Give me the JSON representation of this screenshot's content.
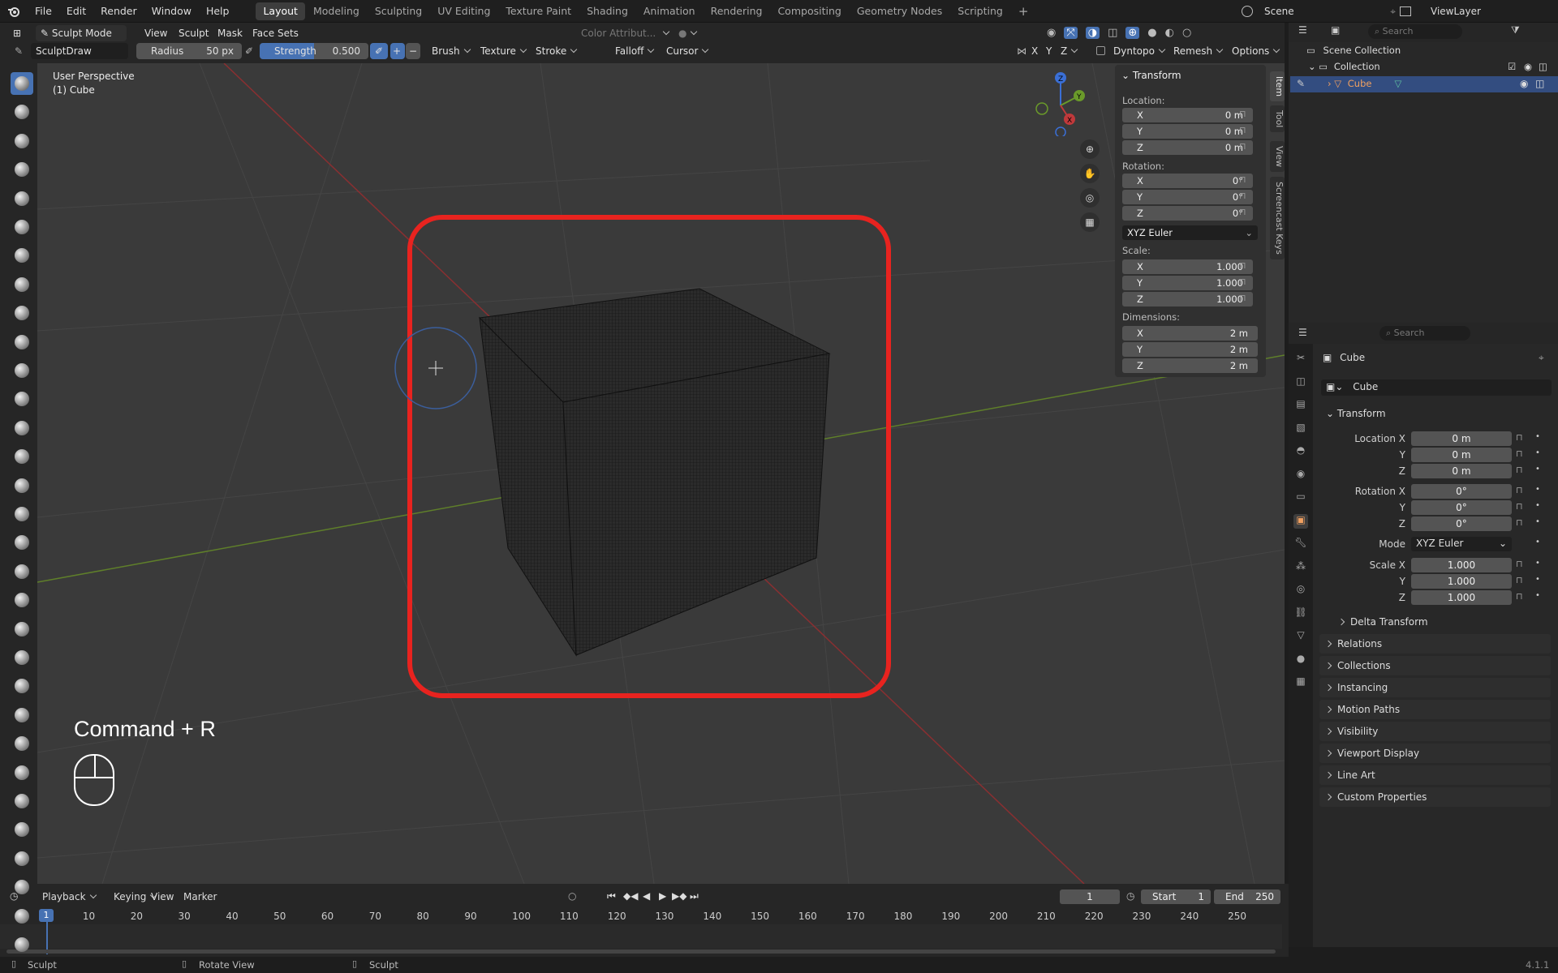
{
  "topbar": {
    "menus": [
      "File",
      "Edit",
      "Render",
      "Window",
      "Help"
    ],
    "workspaces": [
      "Layout",
      "Modeling",
      "Sculpting",
      "UV Editing",
      "Texture Paint",
      "Shading",
      "Animation",
      "Rendering",
      "Compositing",
      "Geometry Nodes",
      "Scripting"
    ],
    "active_workspace": "Layout",
    "scene": "Scene",
    "view_layer": "ViewLayer"
  },
  "header": {
    "mode": "Sculpt Mode",
    "menus": [
      "View",
      "Sculpt",
      "Mask",
      "Face Sets"
    ],
    "color_attr": "Color Attribut...",
    "brush_name": "SculptDraw",
    "radius_label": "Radius",
    "radius_value": "50 px",
    "strength_label": "Strength",
    "strength_value": "0.500",
    "dropdowns": [
      "Brush",
      "Texture",
      "Stroke",
      "Falloff",
      "Cursor"
    ],
    "axes": [
      "X",
      "Y",
      "Z"
    ],
    "dyntopo": "Dyntopo",
    "remesh": "Remesh",
    "options": "Options"
  },
  "viewport": {
    "perspective": "User Perspective",
    "object": "(1) Cube",
    "shortcut": "Command + R"
  },
  "npanel": {
    "title": "Transform",
    "location_label": "Location:",
    "location": [
      {
        "ax": "X",
        "v": "0 m"
      },
      {
        "ax": "Y",
        "v": "0 m"
      },
      {
        "ax": "Z",
        "v": "0 m"
      }
    ],
    "rotation_label": "Rotation:",
    "rotation": [
      {
        "ax": "X",
        "v": "0°"
      },
      {
        "ax": "Y",
        "v": "0°"
      },
      {
        "ax": "Z",
        "v": "0°"
      }
    ],
    "rotation_mode": "XYZ Euler",
    "scale_label": "Scale:",
    "scale": [
      {
        "ax": "X",
        "v": "1.000"
      },
      {
        "ax": "Y",
        "v": "1.000"
      },
      {
        "ax": "Z",
        "v": "1.000"
      }
    ],
    "dimensions_label": "Dimensions:",
    "dimensions": [
      {
        "ax": "X",
        "v": "2 m"
      },
      {
        "ax": "Y",
        "v": "2 m"
      },
      {
        "ax": "Z",
        "v": "2 m"
      }
    ],
    "tabs": [
      "Item",
      "Tool",
      "View",
      "Screencast Keys"
    ]
  },
  "outliner": {
    "search_placeholder": "Search",
    "scene_collection": "Scene Collection",
    "collection": "Collection",
    "object": "Cube"
  },
  "properties": {
    "search_placeholder": "Search",
    "object_name": "Cube",
    "datablock": "Cube",
    "transform": "Transform",
    "location_x_label": "Location X",
    "y_label": "Y",
    "z_label": "Z",
    "location": [
      "0 m",
      "0 m",
      "0 m"
    ],
    "rotation_x_label": "Rotation X",
    "rotation": [
      "0°",
      "0°",
      "0°"
    ],
    "mode_label": "Mode",
    "mode_value": "XYZ Euler",
    "scale_x_label": "Scale X",
    "scale": [
      "1.000",
      "1.000",
      "1.000"
    ],
    "delta": "Delta Transform",
    "sections": [
      "Relations",
      "Collections",
      "Instancing",
      "Motion Paths",
      "Visibility",
      "Viewport Display",
      "Line Art",
      "Custom Properties"
    ]
  },
  "timeline": {
    "menus": [
      "Playback",
      "Keying",
      "View",
      "Marker"
    ],
    "current_frame": "1",
    "start_label": "Start",
    "start": "1",
    "end_label": "End",
    "end": "250",
    "ticks": [
      "1",
      "10",
      "20",
      "30",
      "40",
      "50",
      "60",
      "70",
      "80",
      "90",
      "100",
      "110",
      "120",
      "130",
      "140",
      "150",
      "160",
      "170",
      "180",
      "190",
      "200",
      "210",
      "220",
      "230",
      "240",
      "250"
    ]
  },
  "status": {
    "left": "Sculpt",
    "middle": "Rotate View",
    "right": "Sculpt",
    "version": "4.1.1"
  },
  "colors": {
    "accent": "#4772b3",
    "highlight": "#e8231f",
    "x_axis": "#c0393b",
    "y_axis": "#6a9a2a",
    "z_axis": "#3a6fd6"
  }
}
